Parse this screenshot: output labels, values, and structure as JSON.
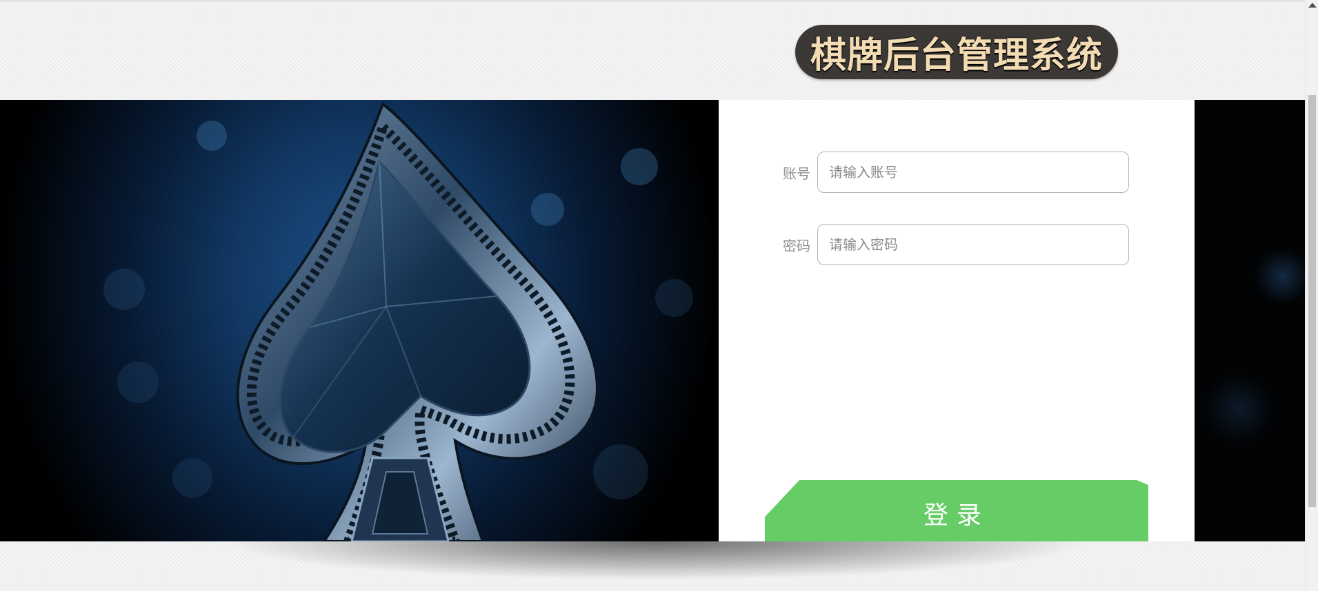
{
  "header": {
    "title": "棋牌后台管理系统"
  },
  "login_form": {
    "account_label": "账号",
    "account_placeholder": "请输入账号",
    "account_value": "",
    "password_label": "密码",
    "password_placeholder": "请输入密码",
    "password_value": "",
    "login_button_label": "登录"
  },
  "hero": {
    "image_subject": "spade-card-suit"
  },
  "colors": {
    "title_background": "#3b3836",
    "title_text": "#f3dcb3",
    "login_button": "#66cc66",
    "panel_background": "#ffffff"
  }
}
